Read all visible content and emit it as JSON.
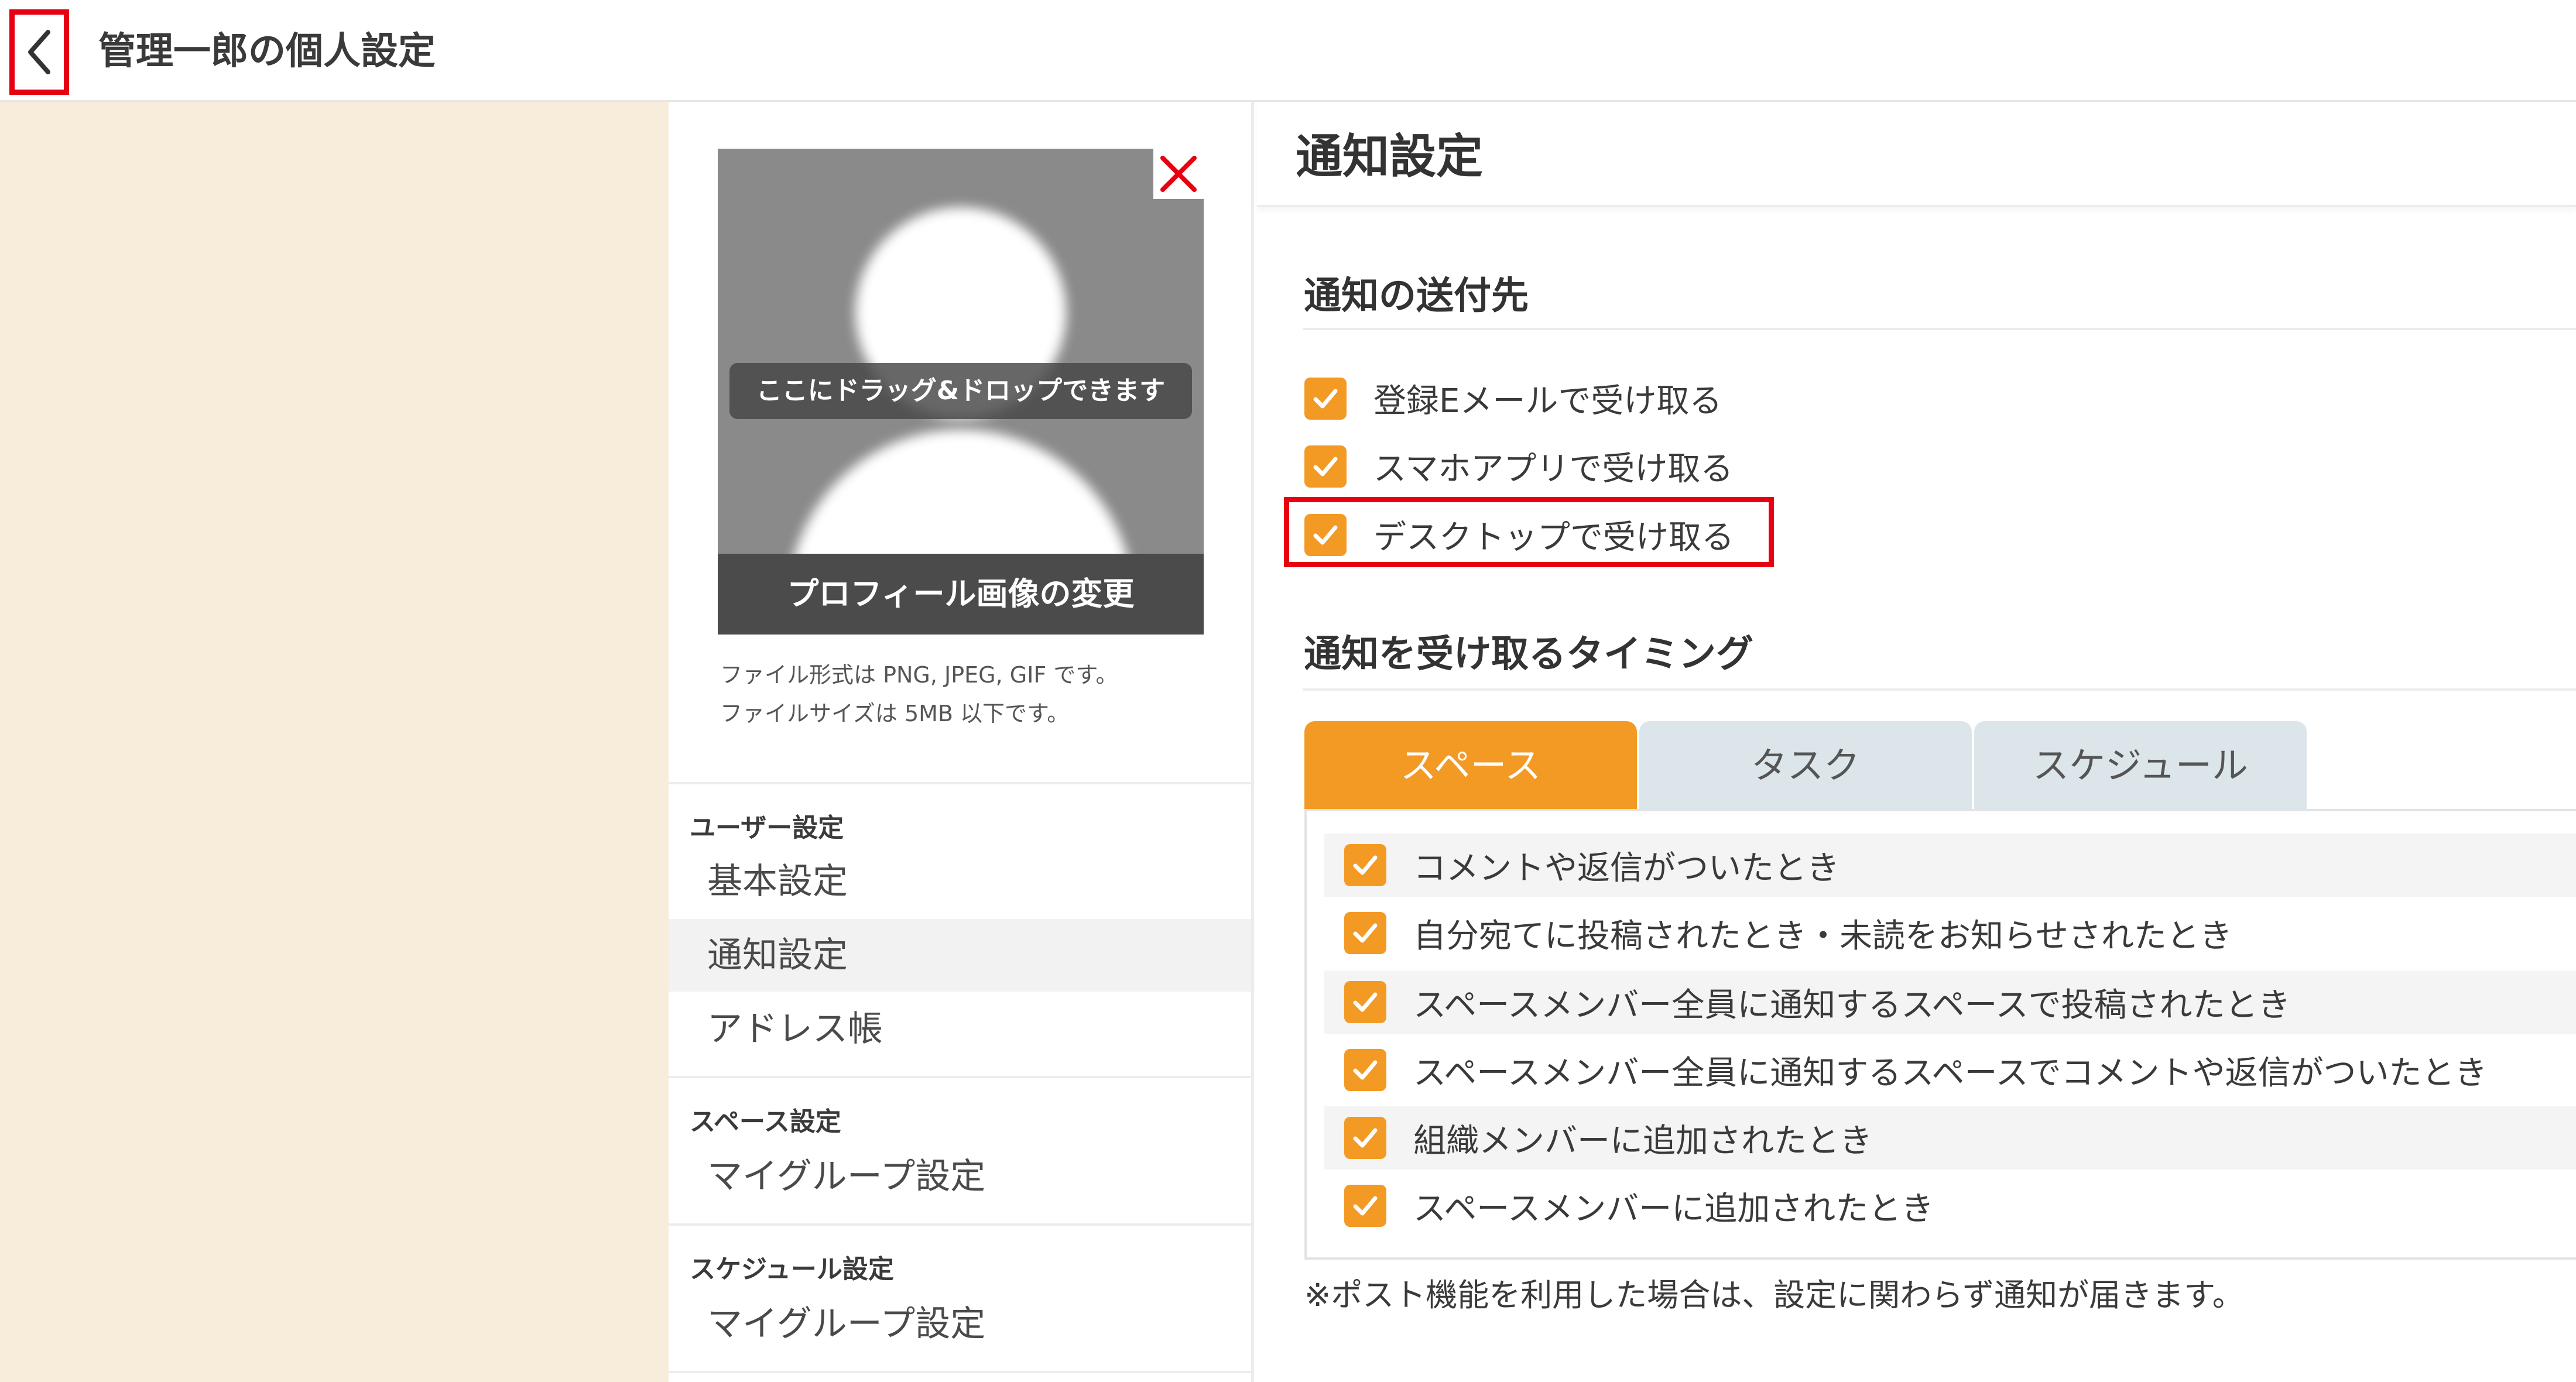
{
  "header": {
    "title": "管理一郎の個人設定",
    "back_icon": "chevron-left-icon"
  },
  "profile": {
    "drop_hint": "ここにドラッグ&ドロップできます",
    "change_label": "プロフィール画像の変更",
    "remove_icon": "close-icon",
    "file_note_1": "ファイル形式は PNG, JPEG, GIF です。",
    "file_note_2": "ファイルサイズは 5MB 以下です。"
  },
  "menu": {
    "sections": [
      {
        "title": "ユーザー設定",
        "items": [
          {
            "label": "基本設定",
            "active": false
          },
          {
            "label": "通知設定",
            "active": true
          },
          {
            "label": "アドレス帳",
            "active": false
          }
        ]
      },
      {
        "title": "スペース設定",
        "items": [
          {
            "label": "マイグループ設定",
            "active": false
          }
        ]
      },
      {
        "title": "スケジュール設定",
        "items": [
          {
            "label": "マイグループ設定",
            "active": false
          }
        ]
      }
    ]
  },
  "main": {
    "title": "通知設定",
    "destinations": {
      "title": "通知の送付先",
      "options": [
        {
          "label": "登録Eメールで受け取る",
          "checked": true
        },
        {
          "label": "スマホアプリで受け取る",
          "checked": true
        },
        {
          "label": "デスクトップで受け取る",
          "checked": true,
          "highlighted": true
        }
      ]
    },
    "timing": {
      "title": "通知を受け取るタイミング",
      "tabs": [
        {
          "label": "スペース",
          "active": true
        },
        {
          "label": "タスク",
          "active": false
        },
        {
          "label": "スケジュール",
          "active": false
        }
      ],
      "options": [
        {
          "label": "コメントや返信がついたとき",
          "checked": true
        },
        {
          "label": "自分宛てに投稿されたとき・未読をお知らせされたとき",
          "checked": true
        },
        {
          "label": "スペースメンバー全員に通知するスペースで投稿されたとき",
          "checked": true
        },
        {
          "label": "スペースメンバー全員に通知するスペースでコメントや返信がついたとき",
          "checked": true
        },
        {
          "label": "組織メンバーに追加されたとき",
          "checked": true
        },
        {
          "label": "スペースメンバーに追加されたとき",
          "checked": true
        }
      ]
    },
    "note": "※ポスト機能を利用した場合は、設定に関わらず通知が届きます。"
  },
  "colors": {
    "accent": "#f39a25",
    "highlight": "#e60012",
    "beige": "#f8eddb",
    "tab_inactive": "#dce5ea"
  }
}
